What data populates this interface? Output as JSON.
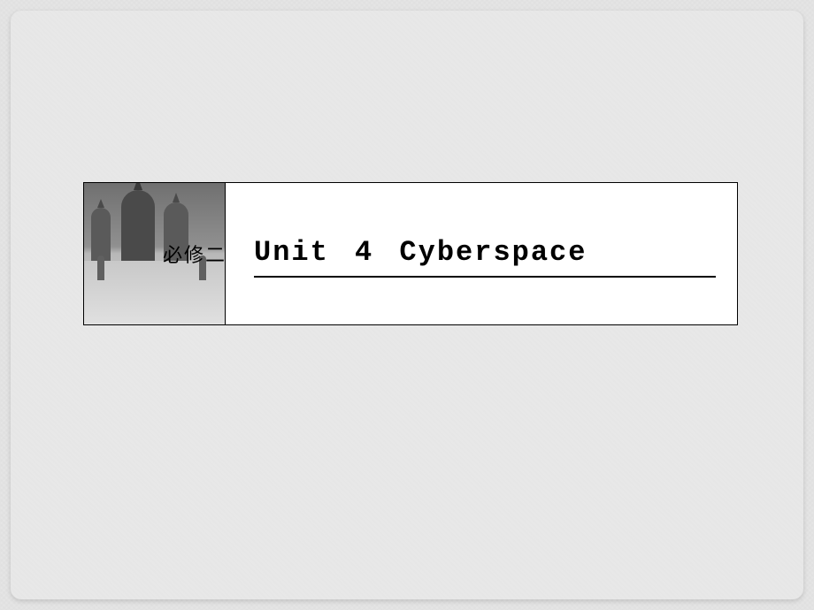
{
  "slide": {
    "category_label": "必修二",
    "unit_title": "Unit 4  Cyberspace"
  }
}
